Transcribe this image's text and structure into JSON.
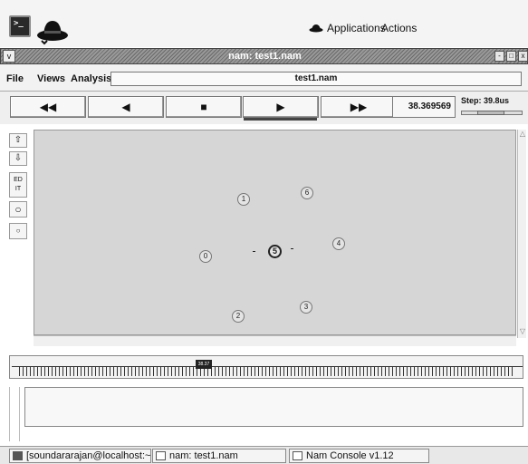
{
  "panel": {
    "terminal_icon": "terminal-icon",
    "hat_icon": "redhat-icon",
    "menu_applications": "Applications",
    "menu_actions": "Actions"
  },
  "window": {
    "title": "nam: test1.nam",
    "menu_btn": "v",
    "minimize": "-",
    "maximize": "□",
    "close": "x"
  },
  "menubar": {
    "file": "File",
    "views": "Views",
    "analysis": "Analysis",
    "file_name": "test1.nam"
  },
  "controls": {
    "rewind": "◀◀",
    "back": "◀",
    "stop": "■",
    "play": "▶",
    "fast_forward": "▶▶",
    "current_time": "38.369569",
    "step_label": "Step: 39.8us",
    "step_position": 0.45
  },
  "tools": {
    "zoom_in": "⇧",
    "zoom_out": "⇩",
    "edit_top": "ED",
    "edit_bottom": "IT",
    "circle": "○",
    "small_circle": "○"
  },
  "nodes": [
    {
      "label": "1"
    },
    {
      "label": "6"
    },
    {
      "label": "0"
    },
    {
      "label": "5"
    },
    {
      "label": "4"
    },
    {
      "label": "3"
    },
    {
      "label": "2"
    }
  ],
  "timeline": {
    "thumb_label": "38.37",
    "position": 0.37
  },
  "taskbar": {
    "items": [
      {
        "label": "[soundararajan@localhost:~/De"
      },
      {
        "label": "nam: test1.nam"
      },
      {
        "label": "Nam Console v1.12"
      }
    ]
  },
  "colors": {
    "canvas_bg": "#d6d6d6",
    "titlebar": "#808080"
  }
}
